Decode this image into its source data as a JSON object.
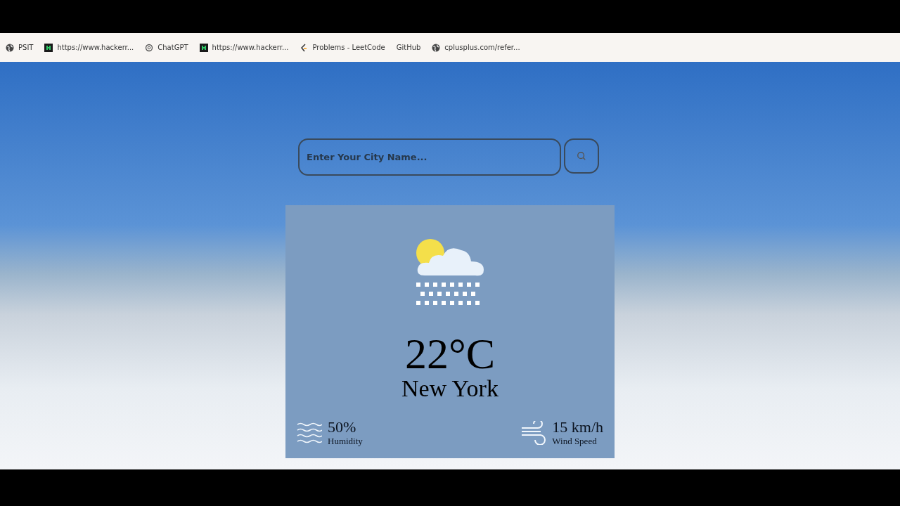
{
  "bookmarks": [
    {
      "label": "PSIT",
      "kind": "globe"
    },
    {
      "label": "https://www.hackerr...",
      "kind": "square"
    },
    {
      "label": "ChatGPT",
      "kind": "flower"
    },
    {
      "label": "https://www.hackerr...",
      "kind": "square"
    },
    {
      "label": "Problems - LeetCode",
      "kind": "bracket"
    },
    {
      "label": "GitHub",
      "kind": "plain"
    },
    {
      "label": "cplusplus.com/refer...",
      "kind": "globe"
    }
  ],
  "search": {
    "placeholder": "Enter Your City Name..."
  },
  "weather": {
    "temperature": "22°C",
    "city": "New York",
    "humidity": {
      "value": "50%",
      "label": "Humidity"
    },
    "wind": {
      "value": "15 km/h",
      "label": "Wind Speed"
    }
  }
}
